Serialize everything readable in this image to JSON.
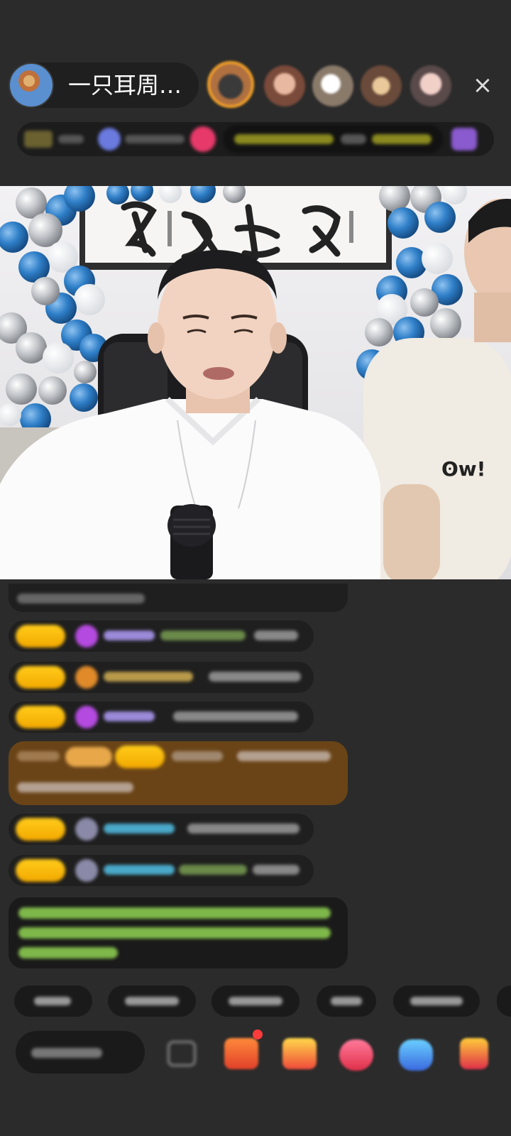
{
  "header": {
    "host_name": "一只耳周…",
    "close_icon": "×"
  },
  "colors": {
    "background": "#2b2b2b",
    "badge_gold": "#f5b400",
    "highlight_message": "#6a4417",
    "system_text": "#8fd14f"
  },
  "icons": {
    "host_avatar": "avatar",
    "close": "close-icon",
    "comment": "comment-icon",
    "gift_box": "gift-box-icon",
    "gift": "gift-icon",
    "heart": "heart-icon",
    "game": "game-icon",
    "more": "more-icon"
  }
}
